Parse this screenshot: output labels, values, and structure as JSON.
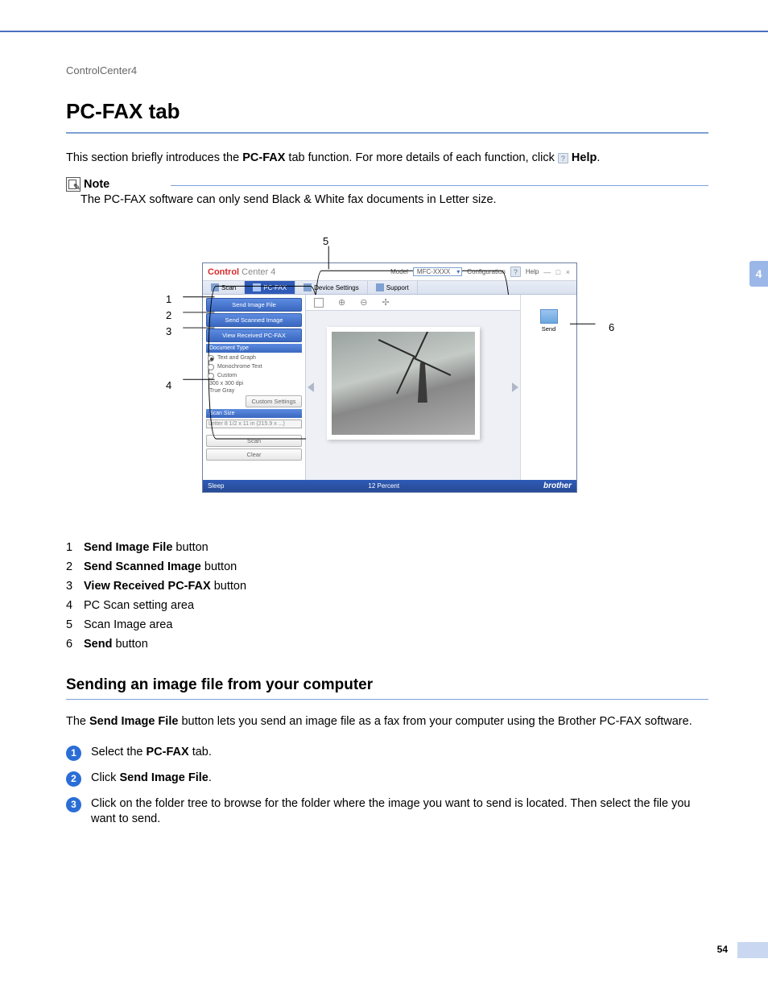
{
  "header_small": "ControlCenter4",
  "page_title": "PC-FAX tab",
  "intro": {
    "pre": "This section briefly introduces the ",
    "bold1": "PC-FAX",
    "mid": " tab function. For more details of each function, click ",
    "help_bold": " Help",
    "end": "."
  },
  "note": {
    "label": "Note",
    "body": "The PC-FAX software can only send Black & White fax documents in Letter size."
  },
  "callouts": {
    "c1": "1",
    "c2": "2",
    "c3": "3",
    "c4": "4",
    "c5": "5",
    "c6": "6"
  },
  "cc4": {
    "logo_bold": "Control",
    "logo_rest": " Center 4",
    "model_label": "Model",
    "model_value": "MFC-XXXX",
    "config": "Configuration",
    "help": "Help",
    "tabs": {
      "scan": "Scan",
      "pcfax": "PC-FAX",
      "dev": "Device Settings",
      "support": "Support"
    },
    "left": {
      "btn1": "Send Image File",
      "btn2": "Send Scanned Image",
      "btn3": "View Received PC-FAX",
      "doc_type": "Document Type",
      "opt1": "Text and Graph",
      "opt2": "Monochrome Text",
      "opt3": "Custom",
      "res": "300 x 300 dpi",
      "gray": "True Gray",
      "custom_settings": "Custom Settings",
      "scan_size": "Scan Size",
      "size_value": "Letter 8 1/2 x 11 in (215.9 x ...)",
      "scan_btn": "Scan",
      "clear_btn": "Clear"
    },
    "right": {
      "send": "Send"
    },
    "status": {
      "left": "Sleep",
      "mid": "12 Percent",
      "brand": "brother"
    }
  },
  "legend": [
    {
      "n": "1",
      "bold": "Send Image File",
      "rest": " button"
    },
    {
      "n": "2",
      "bold": "Send Scanned Image",
      "rest": " button"
    },
    {
      "n": "3",
      "bold": "View Received PC-FAX",
      "rest": " button"
    },
    {
      "n": "4",
      "bold": "",
      "rest": "PC Scan setting area"
    },
    {
      "n": "5",
      "bold": "",
      "rest": "Scan Image area"
    },
    {
      "n": "6",
      "bold": "Send",
      "rest": " button"
    }
  ],
  "subsection_title": "Sending an image file from your computer",
  "para": {
    "pre": "The ",
    "bold": "Send Image File",
    "post": " button lets you send an image file as a fax from your computer using the Brother PC-FAX software."
  },
  "steps": [
    {
      "n": "1",
      "pre": "Select the ",
      "bold": "PC-FAX",
      "post": " tab."
    },
    {
      "n": "2",
      "pre": "Click ",
      "bold": "Send Image File",
      "post": "."
    },
    {
      "n": "3",
      "pre": "",
      "bold": "",
      "post": "Click on the folder tree to browse for the folder where the image you want to send is located. Then select the file you want to send."
    }
  ],
  "side_tab": "4",
  "page_number": "54"
}
